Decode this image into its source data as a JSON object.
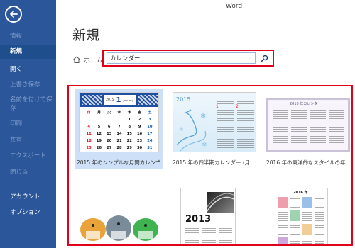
{
  "app": {
    "title": "Word"
  },
  "sidebar": {
    "items": [
      {
        "label": "情報"
      },
      {
        "label": "新規"
      },
      {
        "label": "開く"
      },
      {
        "label": "上書き保存"
      },
      {
        "label": "名前を付けて保存"
      },
      {
        "label": "印刷"
      },
      {
        "label": "共有"
      },
      {
        "label": "エクスポート"
      },
      {
        "label": "閉じる"
      },
      {
        "label": "アカウント"
      },
      {
        "label": "オプション"
      }
    ]
  },
  "main": {
    "title": "新規",
    "home_label": "ホーム",
    "search": {
      "value": "カレンダー"
    }
  },
  "templates": [
    {
      "label": "2015 年のシンプルな月間カレン...",
      "thumb_year": "2015",
      "thumb_month": "1",
      "thumb_month_en": "January"
    },
    {
      "label": "2015 年の四半期カレンダー (月...",
      "thumb_year": "2015"
    },
    {
      "label": "2016 年の東洋的なスタイルの年...",
      "thumb_title": "2016 年カレンダー"
    },
    {
      "label": ""
    },
    {
      "label": "",
      "thumb_year": "2013"
    },
    {
      "label": "",
      "thumb_year": "2016 年"
    }
  ],
  "calendar_days": {
    "headers": [
      "日",
      "月",
      "火",
      "水",
      "木",
      "金",
      "土"
    ],
    "rows": [
      [
        "",
        "",
        "",
        "",
        "1",
        "2",
        "3"
      ],
      [
        "4",
        "5",
        "6",
        "7",
        "8",
        "9",
        "10"
      ],
      [
        "11",
        "12",
        "13",
        "14",
        "15",
        "16",
        "17"
      ],
      [
        "18",
        "19",
        "20",
        "21",
        "22",
        "23",
        "24"
      ],
      [
        "25",
        "26",
        "27",
        "28",
        "29",
        "30",
        "31"
      ]
    ]
  },
  "colors": {
    "sidebar": "#2b579a",
    "highlight": "#e0001b",
    "selected_tile": "#cde0f7"
  }
}
